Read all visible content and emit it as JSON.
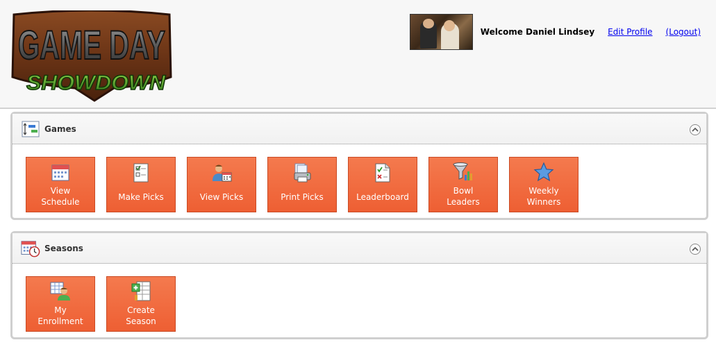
{
  "header": {
    "logo": {
      "line1": "GAME DAY",
      "line2": "SHOWDOWN"
    },
    "welcome": "Welcome Daniel Lindsey",
    "edit_profile": "Edit Profile",
    "logout": "(Logout)"
  },
  "panels": {
    "games": {
      "title": "Games",
      "icon": "games-chart-icon",
      "tiles": [
        {
          "label": "View\nSchedule",
          "icon": "calendar-icon"
        },
        {
          "label": "Make Picks",
          "icon": "checklist-icon"
        },
        {
          "label": "View Picks",
          "icon": "user-calendar-icon"
        },
        {
          "label": "Print Picks",
          "icon": "printer-icon"
        },
        {
          "label": "Leaderboard",
          "icon": "document-check-icon"
        },
        {
          "label": "Bowl\nLeaders",
          "icon": "funnel-chart-icon"
        },
        {
          "label": "Weekly\nWinners",
          "icon": "star-icon"
        }
      ]
    },
    "seasons": {
      "title": "Seasons",
      "icon": "calendar-clock-icon",
      "tiles": [
        {
          "label": "My\nEnrollment",
          "icon": "user-grid-icon"
        },
        {
          "label": "Create\nSeason",
          "icon": "add-table-icon"
        }
      ]
    }
  },
  "colors": {
    "tile": "#f06a3e",
    "tile_border": "#c94a24",
    "panel_border": "#cfcfcf",
    "link": "#0000ee"
  }
}
